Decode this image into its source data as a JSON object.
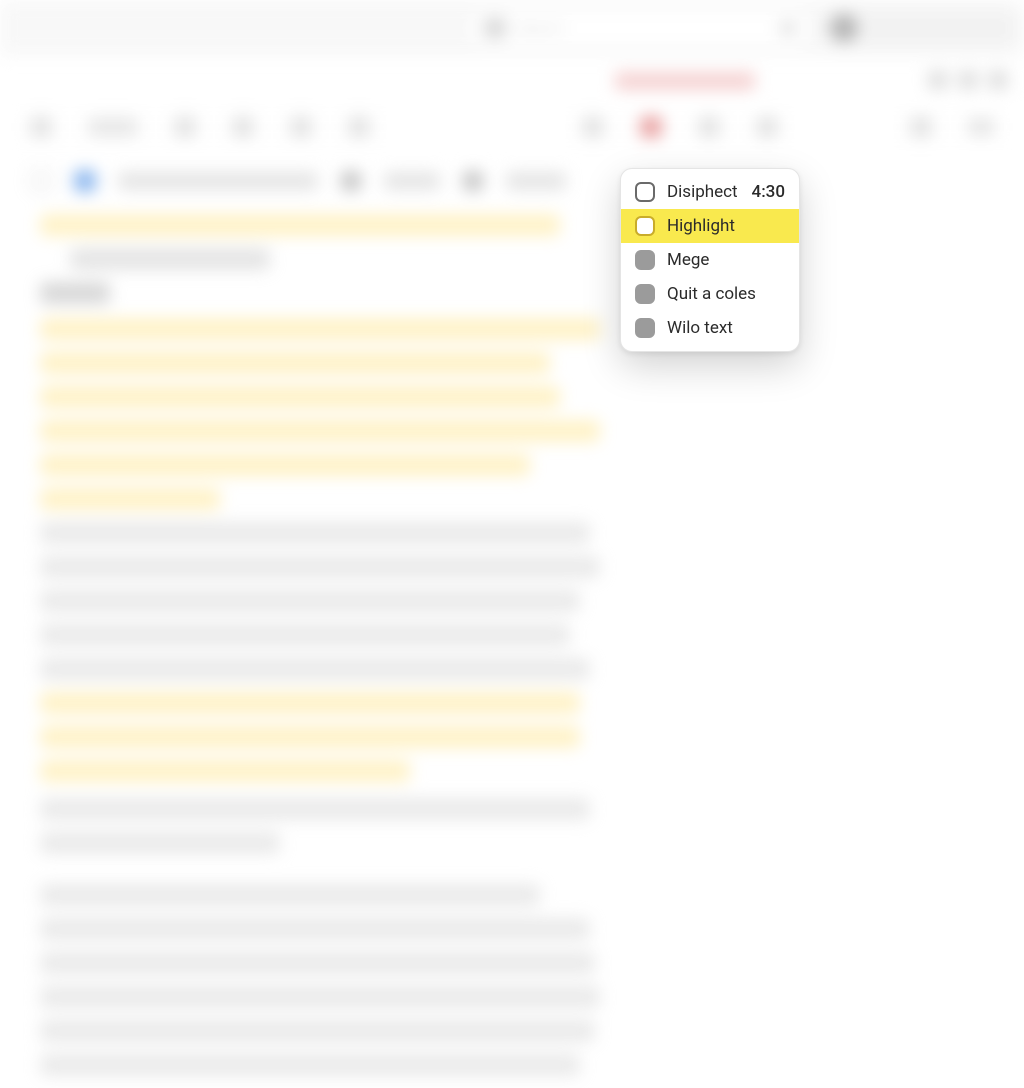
{
  "topbar": {
    "search_placeholder": "Search"
  },
  "popup": {
    "items": [
      {
        "label": "Disiphect",
        "time": "4:30",
        "selected": false,
        "filled": false
      },
      {
        "label": "Highlight",
        "time": "",
        "selected": true,
        "filled": false
      },
      {
        "label": "Mege",
        "time": "",
        "selected": false,
        "filled": true
      },
      {
        "label": "Quit a coles",
        "time": "",
        "selected": false,
        "filled": true
      },
      {
        "label": "Wilo text",
        "time": "",
        "selected": false,
        "filled": true
      }
    ]
  }
}
